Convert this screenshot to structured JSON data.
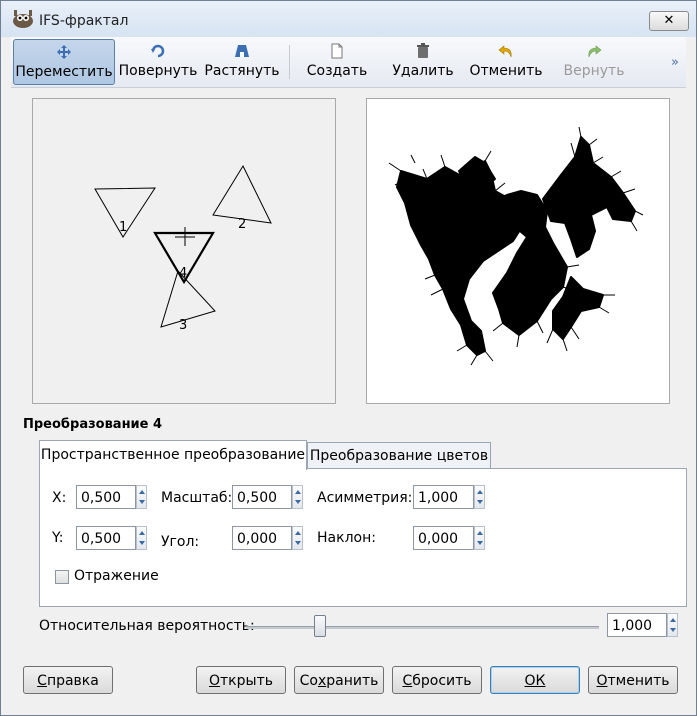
{
  "window": {
    "title": "IFS-фрактал",
    "close_label": "✕",
    "icon": "gimp-wilber-icon"
  },
  "toolbar": {
    "items": [
      {
        "label": "Переместить",
        "icon": "move-arrows-icon",
        "active": true
      },
      {
        "label": "Повернуть",
        "icon": "rotate-icon"
      },
      {
        "label": "Растянуть",
        "icon": "stretch-icon"
      },
      {
        "label": "Создать",
        "icon": "new-page-icon"
      },
      {
        "label": "Удалить",
        "icon": "trash-can-icon"
      },
      {
        "label": "Отменить",
        "icon": "undo-arrow-icon"
      },
      {
        "label": "Вернуть",
        "icon": "redo-arrow-icon",
        "disabled": true
      }
    ],
    "overflow": "»"
  },
  "design_panel": {
    "triangle_labels": [
      "1",
      "2",
      "3",
      "4"
    ]
  },
  "transform": {
    "title": "Преобразование 4",
    "tabs": [
      "Пространственное преобразование",
      "Преобразование цветов"
    ],
    "active_tab": 0,
    "fields": {
      "x": {
        "label": "X:",
        "value": "0,500"
      },
      "y": {
        "label": "Y:",
        "value": "0,500"
      },
      "scale": {
        "label": "Масштаб:",
        "value": "0,500"
      },
      "angle": {
        "label": "Угол:",
        "value": "0,000"
      },
      "asymmetry": {
        "label": "Асимметрия:",
        "value": "1,000"
      },
      "shear": {
        "label": "Наклон:",
        "value": "0,000"
      }
    },
    "flip_label": "Отражение",
    "flip_checked": false
  },
  "probability": {
    "label": "Относительная вероятность:",
    "value": "1,000",
    "slider_fraction": 0.2
  },
  "buttons": {
    "help": {
      "ul": "С",
      "rest": "правка"
    },
    "open": {
      "ul": "О",
      "rest": "ткрыть"
    },
    "save_pre": "Со",
    "save_ul": "х",
    "save_rest": "ранить",
    "reset": {
      "ul": "С",
      "rest": "бросить"
    },
    "ok": {
      "ul": "О",
      "rest": "К"
    },
    "cancel": {
      "ul": "О",
      "rest": "тменить"
    }
  }
}
